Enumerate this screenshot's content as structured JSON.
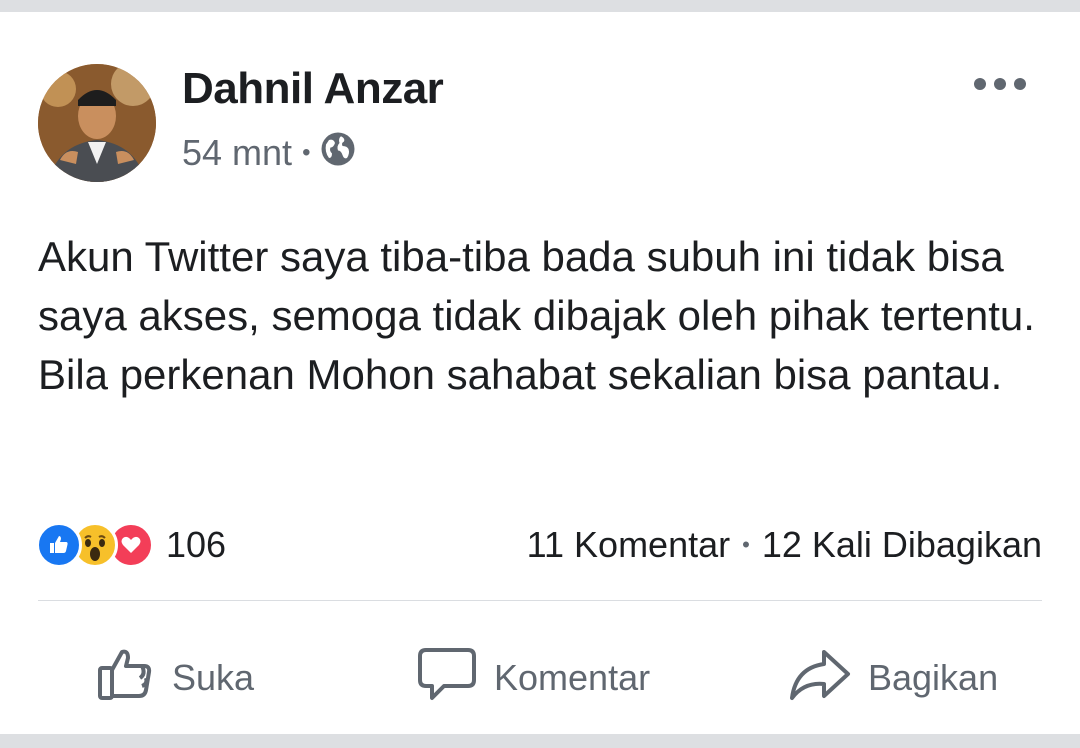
{
  "post": {
    "author": "Dahnil Anzar",
    "time": "54 mnt",
    "separator": "•",
    "privacy_icon": "globe-icon",
    "more_icon": "more-icon",
    "text": "Akun Twitter saya tiba-tiba bada subuh ini tidak bisa saya akses, semoga tidak dibajak oleh pihak tertentu. Bila perkenan Mohon sahabat sekalian bisa pantau."
  },
  "reactions": {
    "icons": [
      "like-reaction-icon",
      "wow-reaction-icon",
      "love-reaction-icon"
    ],
    "count": "106",
    "colors": {
      "like": "#1877f2",
      "wow": "#f7c02a",
      "love": "#f33e58"
    }
  },
  "stats": {
    "comments": "11 Komentar",
    "separator": "•",
    "shares": "12 Kali Dibagikan"
  },
  "actions": {
    "like": "Suka",
    "comment": "Komentar",
    "share": "Bagikan"
  },
  "colors": {
    "text": "#1c1e21",
    "secondary": "#606770",
    "background": "#dddfe2"
  }
}
